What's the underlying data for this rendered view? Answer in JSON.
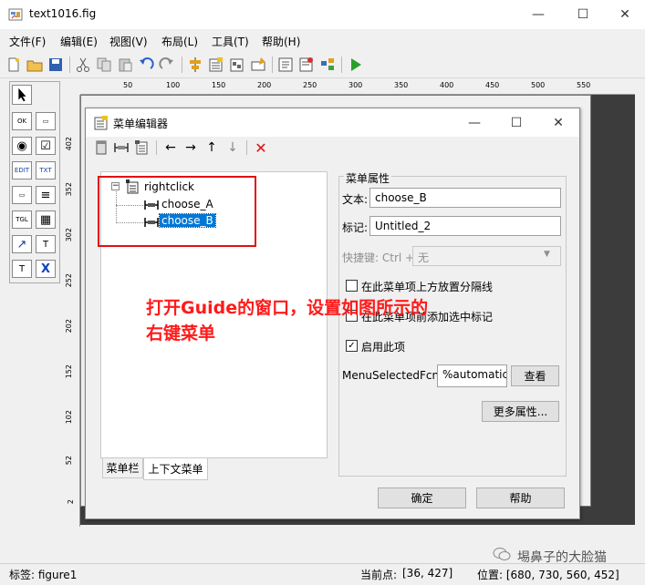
{
  "window": {
    "title": "text1016.fig",
    "minimize_icon": "minimize-icon",
    "maximize_icon": "maximize-icon",
    "close_icon": "close-icon"
  },
  "menubar": {
    "items": [
      {
        "label": "文件(F)"
      },
      {
        "label": "编辑(E)"
      },
      {
        "label": "视图(V)"
      },
      {
        "label": "布局(L)"
      },
      {
        "label": "工具(T)"
      },
      {
        "label": "帮助(H)"
      }
    ]
  },
  "toolbar": {
    "icons": [
      "new-icon",
      "open-icon",
      "save-icon",
      "cut-icon",
      "copy-icon",
      "paste-icon",
      "undo-icon",
      "redo-icon",
      "align-icon",
      "menu-editor-icon",
      "tab-order-icon",
      "toolbar-editor-icon",
      "mfile-editor-icon",
      "property-inspector-icon",
      "object-browser-icon",
      "run-icon"
    ]
  },
  "palette": {
    "items": [
      {
        "label": "OK",
        "icon": "push-button-icon"
      },
      {
        "label": "▭",
        "icon": "slider-icon"
      },
      {
        "label": "◉",
        "icon": "radio-button-icon"
      },
      {
        "label": "☑",
        "icon": "checkbox-icon"
      },
      {
        "label": "EDIT",
        "icon": "edit-text-icon"
      },
      {
        "label": "TXT",
        "icon": "static-text-icon"
      },
      {
        "label": "▭",
        "icon": "popup-menu-icon"
      },
      {
        "label": "≡",
        "icon": "listbox-icon"
      },
      {
        "label": "TGL",
        "icon": "toggle-button-icon"
      },
      {
        "label": "▦",
        "icon": "table-icon"
      },
      {
        "label": "↗",
        "icon": "axes-icon"
      },
      {
        "label": "T",
        "icon": "panel-icon"
      },
      {
        "label": "T",
        "icon": "button-group-icon"
      },
      {
        "label": "X",
        "icon": "activex-icon"
      }
    ]
  },
  "rulers": {
    "top": [
      "50",
      "100",
      "150",
      "200",
      "250",
      "300",
      "350",
      "400",
      "450",
      "500",
      "550"
    ],
    "left": [
      "402",
      "352",
      "302",
      "252",
      "202",
      "152",
      "102",
      "52",
      "2"
    ]
  },
  "dialog": {
    "title": "菜单编辑器",
    "tree": {
      "root": "rightclick",
      "children": [
        "choose_A",
        "choose_B"
      ],
      "selected": "choose_B"
    },
    "tabs": [
      "菜单栏",
      "上下文菜单"
    ],
    "active_tab": "上下文菜单",
    "props": {
      "group_title": "菜单属性",
      "text_label": "文本:",
      "text_value": "choose_B",
      "tag_label": "标记:",
      "tag_value": "Untitled_2",
      "accel_label": "快捷键: Ctrl +",
      "accel_value": "无",
      "separator_label": "在此菜单项上方放置分隔线",
      "separator_checked": false,
      "checkmark_label": "在此菜单项前添加选中标记",
      "checkmark_checked": false,
      "enable_label": "启用此项",
      "enable_checked": true,
      "callback_label": "MenuSelectedFcn:",
      "callback_value": "%automatic",
      "view_button": "查看",
      "more_button": "更多属性..."
    },
    "ok_button": "确定",
    "help_button": "帮助"
  },
  "annotation": {
    "line1": "打开Guide的窗口，设置如图所示的",
    "line2": "右键菜单",
    "color": "#ff1a1a"
  },
  "watermark": "埸鼻子的大脸猫",
  "status": {
    "tag": "标签: figure1",
    "current_point": "当前点:",
    "current_point_value": "[36, 427]",
    "position": "位置: [680, 730, 560, 452]"
  }
}
